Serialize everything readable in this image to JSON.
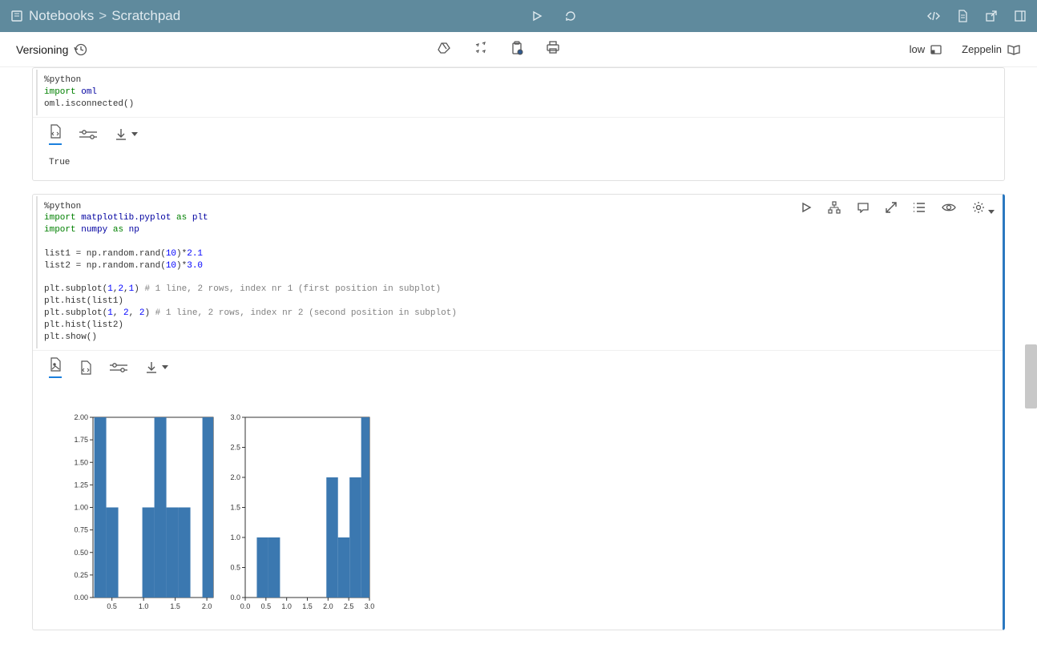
{
  "topbar": {
    "breadcrumb_root": "Notebooks",
    "breadcrumb_sep": ">",
    "breadcrumb_current": "Scratchpad"
  },
  "subbar": {
    "versioning_label": "Versioning",
    "priority_label": "low",
    "engine_label": "Zeppelin"
  },
  "cell1": {
    "code_line1_directive": "%python",
    "code_line2_kw": "import",
    "code_line2_mod": "oml",
    "code_line3": "oml.isconnected()",
    "output": "True"
  },
  "cell2": {
    "code_line1_directive": "%python",
    "code_line2_kw": "import",
    "code_line2_mod": "matplotlib.pyplot",
    "code_line2_as": "as",
    "code_line2_alias": "plt",
    "code_line3_kw": "import",
    "code_line3_mod": "numpy",
    "code_line3_as": "as",
    "code_line3_alias": "np",
    "code_line5_a": "list1 = np.random.rand(",
    "code_line5_n": "10",
    "code_line5_b": ")*",
    "code_line5_n2": "2.1",
    "code_line6_a": "list2 = np.random.rand(",
    "code_line6_n": "10",
    "code_line6_b": ")*",
    "code_line6_n2": "3.0",
    "code_line8_a": "plt.subplot(",
    "code_line8_n1": "1",
    "code_line8_c": ",",
    "code_line8_n2": "2",
    "code_line8_n3": "1",
    "code_line8_b": ") ",
    "code_line8_cmt": "# 1 line, 2 rows, index nr 1 (first position in subplot)",
    "code_line9": "plt.hist(list1)",
    "code_line10_a": "plt.subplot(",
    "code_line10_n1": "1",
    "code_line10_c": ", ",
    "code_line10_n2": "2",
    "code_line10_n3": "2",
    "code_line10_b": ") ",
    "code_line10_cmt": "# 1 line, 2 rows, index nr 2 (second position in subplot)",
    "code_line11": "plt.hist(list2)",
    "code_line12": "plt.show()"
  },
  "chart_data": [
    {
      "type": "bar",
      "xlabel": "",
      "ylabel": "",
      "xlim": [
        0.2,
        2.1
      ],
      "ylim": [
        0,
        2.0
      ],
      "xticks": [
        0.5,
        1.0,
        1.5,
        2.0
      ],
      "yticks": [
        0.0,
        0.25,
        0.5,
        0.75,
        1.0,
        1.25,
        1.5,
        1.75,
        2.0
      ],
      "bars": [
        {
          "x0": 0.22,
          "x1": 0.41,
          "y": 2.0
        },
        {
          "x0": 0.41,
          "x1": 0.6,
          "y": 1.0
        },
        {
          "x0": 0.98,
          "x1": 1.17,
          "y": 1.0
        },
        {
          "x0": 1.17,
          "x1": 1.36,
          "y": 2.0
        },
        {
          "x0": 1.36,
          "x1": 1.55,
          "y": 1.0
        },
        {
          "x0": 1.55,
          "x1": 1.74,
          "y": 1.0
        },
        {
          "x0": 1.93,
          "x1": 2.1,
          "y": 2.0
        }
      ]
    },
    {
      "type": "bar",
      "xlabel": "",
      "ylabel": "",
      "xlim": [
        0.0,
        3.0
      ],
      "ylim": [
        0,
        3.0
      ],
      "xticks": [
        0.0,
        0.5,
        1.0,
        1.5,
        2.0,
        2.5,
        3.0
      ],
      "yticks": [
        0.0,
        0.5,
        1.0,
        1.5,
        2.0,
        2.5,
        3.0
      ],
      "bars": [
        {
          "x0": 0.28,
          "x1": 0.56,
          "y": 1.0
        },
        {
          "x0": 0.56,
          "x1": 0.84,
          "y": 1.0
        },
        {
          "x0": 1.96,
          "x1": 2.24,
          "y": 2.0
        },
        {
          "x0": 2.24,
          "x1": 2.52,
          "y": 1.0
        },
        {
          "x0": 2.52,
          "x1": 2.8,
          "y": 2.0
        },
        {
          "x0": 2.8,
          "x1": 3.0,
          "y": 3.0
        }
      ]
    }
  ]
}
